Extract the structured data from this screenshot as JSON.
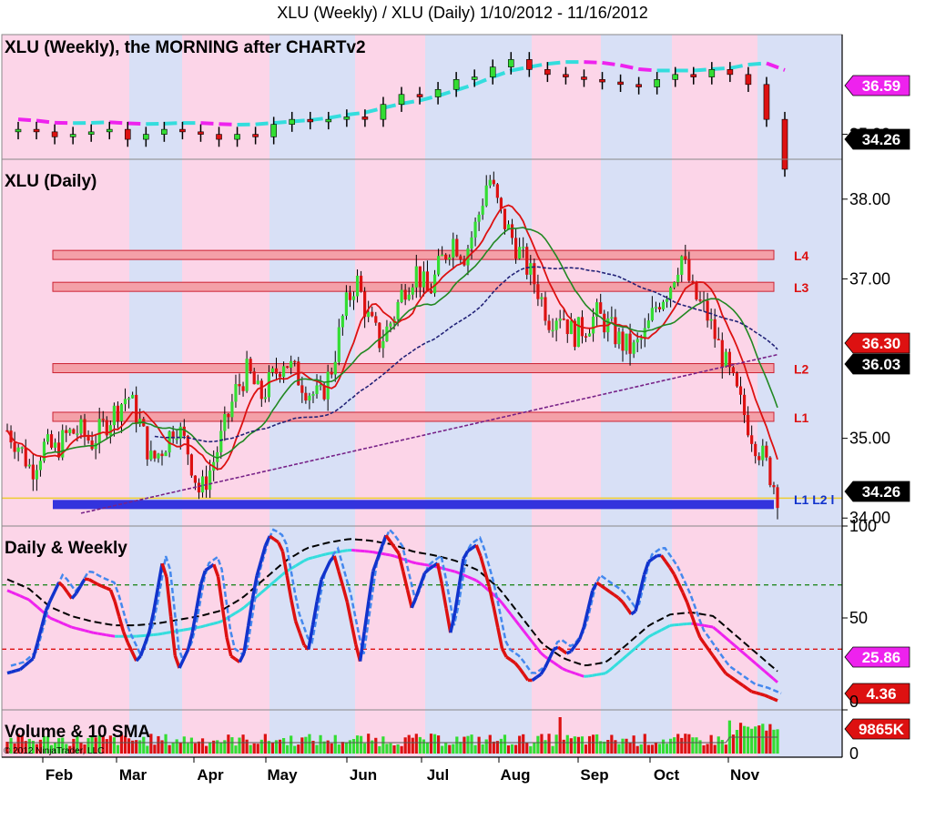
{
  "title": "XLU (Weekly) / XLU (Daily)  1/10/2012 - 11/16/2012",
  "copyright": "© 2012 NinjaTrader, LLC",
  "months": [
    "Feb",
    "Mar",
    "Apr",
    "May",
    "Jun",
    "Jul",
    "Aug",
    "Sep",
    "Oct",
    "Nov"
  ],
  "panels": {
    "weekly": {
      "label": "XLU (Weekly), the MORNING after CHARTv2",
      "ticks": [
        "35.00"
      ],
      "tags": [
        "36.59",
        "34.26"
      ]
    },
    "daily": {
      "label": "XLU (Daily)",
      "ticks": [
        "38.00",
        "37.00",
        "35.00",
        "34.00"
      ],
      "tags": [
        "36.30",
        "36.03",
        "34.26"
      ],
      "bottom_label": "L1 L2 l"
    },
    "osc": {
      "label": "Daily & Weekly",
      "ticks": [
        "100",
        "50",
        "0"
      ],
      "tags": [
        "25.86",
        "4.36"
      ]
    },
    "volume": {
      "label": "Volume & 10 SMA",
      "ticks": [
        "0"
      ],
      "tags": [
        "9865K"
      ]
    }
  },
  "colors": {
    "pink": "#fcd5e8",
    "blue": "#d8e0f6",
    "up": "#33dd33",
    "down": "#dd1111",
    "level": "#f4a0a8",
    "support": "#3333dd"
  },
  "chart_data": [
    {
      "type": "candlestick",
      "title": "XLU (Weekly), the MORNING after CHARTv2",
      "ylim": [
        34.5,
        37.0
      ],
      "annotations": {
        "last_price": 34.26,
        "ma_value": 36.59
      },
      "close": [
        35.1,
        35.05,
        34.95,
        35.0,
        35.05,
        35.1,
        34.9,
        35.0,
        35.1,
        35.05,
        35.0,
        34.9,
        35.0,
        34.95,
        35.2,
        35.3,
        35.25,
        35.3,
        35.35,
        35.3,
        35.6,
        35.8,
        35.75,
        35.9,
        36.1,
        36.15,
        36.35,
        36.5,
        36.3,
        36.2,
        36.15,
        36.1,
        36.05,
        36.0,
        35.95,
        36.1,
        36.2,
        36.15,
        36.3,
        36.2,
        36.0,
        35.3,
        34.3
      ]
    },
    {
      "type": "candlestick",
      "title": "XLU (Daily)",
      "ylim": [
        33.9,
        38.5
      ],
      "levels": [
        {
          "name": "L4",
          "value": 37.3
        },
        {
          "name": "L3",
          "value": 36.9
        },
        {
          "name": "L2",
          "value": 35.88
        },
        {
          "name": "L1",
          "value": 35.27
        },
        {
          "name": "support",
          "value": 34.17
        }
      ],
      "annotations": {
        "last_price": 34.26,
        "sma_fast": 36.3,
        "sma_slow": 36.03
      },
      "close": [
        35.1,
        34.9,
        34.6,
        34.9,
        34.85,
        35.05,
        35.1,
        34.95,
        35.15,
        35.35,
        35.55,
        35.2,
        34.7,
        34.9,
        35.2,
        34.85,
        34.3,
        34.65,
        35.1,
        35.6,
        35.85,
        35.5,
        35.75,
        36.0,
        35.8,
        35.6,
        35.5,
        35.9,
        36.6,
        37.0,
        36.5,
        36.2,
        36.5,
        36.9,
        37.1,
        36.8,
        37.2,
        37.5,
        37.3,
        37.7,
        38.3,
        37.8,
        37.5,
        37.2,
        36.9,
        36.5,
        36.6,
        36.3,
        36.4,
        36.55,
        36.4,
        36.2,
        36.1,
        36.3,
        36.7,
        36.9,
        37.3,
        36.8,
        36.6,
        36.2,
        35.8,
        35.4,
        35.0,
        34.7,
        34.3
      ],
      "sma_fast": [
        35.0,
        35.0,
        34.95,
        34.9,
        34.9,
        34.95,
        35.0,
        35.0,
        35.05,
        35.1,
        35.2,
        35.2,
        35.1,
        35.0,
        34.95,
        34.9,
        34.8,
        34.75,
        34.8,
        34.95,
        35.15,
        35.3,
        35.45,
        35.6,
        35.7,
        35.75,
        35.75,
        35.8,
        35.95,
        36.15,
        36.3,
        36.35,
        36.4,
        36.5,
        36.6,
        36.7,
        36.8,
        36.95,
        37.05,
        37.15,
        37.3,
        37.45,
        37.5,
        37.45,
        37.35,
        37.2,
        37.05,
        36.9,
        36.75,
        36.6,
        36.5,
        36.45,
        36.4,
        36.45,
        36.55,
        36.65,
        36.75,
        36.8,
        36.8,
        36.75,
        36.65,
        36.5,
        36.3
      ]
    },
    {
      "type": "line",
      "title": "Daily & Weekly",
      "ylim": [
        0,
        100
      ],
      "reference_lines": [
        68,
        33
      ],
      "series": [
        {
          "values": [
            20,
            22,
            28,
            55,
            70,
            60,
            72,
            68,
            65,
            40,
            25,
            45,
            85,
            20,
            35,
            75,
            80,
            30,
            25,
            70,
            95,
            90,
            50,
            30,
            70,
            85,
            60,
            25,
            75,
            95,
            85,
            55,
            75,
            80,
            40,
            85,
            90,
            65,
            30,
            25,
            15,
            20,
            35,
            30,
            40,
            70,
            65,
            60,
            50,
            80,
            85,
            75,
            60,
            40,
            30,
            20,
            15,
            10,
            8,
            5
          ]
        },
        {
          "values": [
            65,
            60,
            50,
            45,
            42,
            40,
            40,
            41,
            43,
            45,
            48,
            55,
            65,
            75,
            82,
            85,
            87,
            86,
            84,
            80,
            78,
            75,
            70,
            60,
            45,
            30,
            22,
            18,
            20,
            30,
            40,
            46,
            47,
            45,
            35,
            25,
            15
          ]
        }
      ],
      "annotations": {
        "weekly_value": 25.86,
        "daily_value": 4.36
      }
    },
    {
      "type": "bar",
      "title": "Volume & 10 SMA",
      "annotations": {
        "last_volume": "9865K"
      }
    }
  ]
}
